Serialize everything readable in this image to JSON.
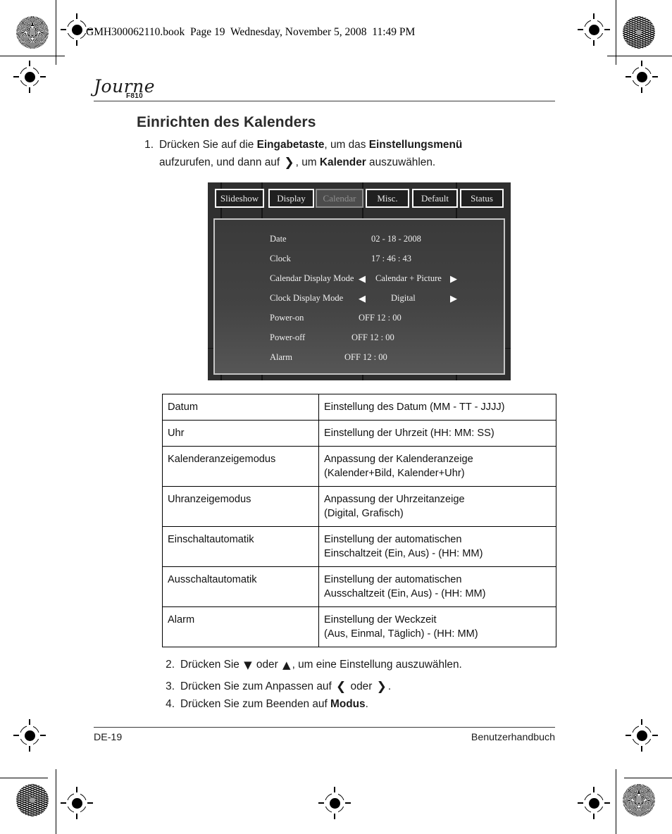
{
  "book_header": "GMH300062110.book  Page 19  Wednesday, November 5, 2008  11:49 PM",
  "logo": {
    "wordmark": "Journe",
    "model": "F810"
  },
  "title": "Einrichten des Kalenders",
  "steps": {
    "s1_num": "1.",
    "s1_a": "Drücken Sie auf die ",
    "s1_b": "Eingabetaste",
    "s1_c": ", um das ",
    "s1_d": "Einstellungsmenü",
    "s1_e": "aufzurufen, und dann auf ",
    "s1_glyph": "❯",
    "s1_f": ", um ",
    "s1_g": "Kalender",
    "s1_h": " auszuwählen.",
    "s2_num": "2.",
    "s2_a": "Drücken Sie ",
    "s2_glyph_down": "▼",
    "s2_b": " oder ",
    "s2_glyph_up": "▲",
    "s2_c": ", um eine Einstellung auszuwählen.",
    "s3_num": "3.",
    "s3_a": "Drücken Sie zum Anpassen auf ",
    "s3_glyph_left": "❮",
    "s3_b": " oder ",
    "s3_glyph_right": "❯",
    "s3_c": ".",
    "s4_num": "4.",
    "s4_a": "Drücken Sie zum Beenden auf ",
    "s4_b": "Modus",
    "s4_c": "."
  },
  "device": {
    "tabs": [
      {
        "label": "Slideshow",
        "selected": false
      },
      {
        "label": "Display",
        "selected": false
      },
      {
        "label": "Calendar",
        "selected": true
      },
      {
        "label": "Misc.",
        "selected": false
      },
      {
        "label": "Default",
        "selected": false
      },
      {
        "label": "Status",
        "selected": false
      }
    ],
    "rows": [
      {
        "label": "Date",
        "value": "02   -   18   - 2008",
        "left_arrow": "",
        "right_arrow": ""
      },
      {
        "label": "Clock",
        "value": "17   :   46   : 43",
        "left_arrow": "",
        "right_arrow": ""
      },
      {
        "label": "Calendar Display Mode",
        "value": "Calendar + Picture",
        "left_arrow": "◀",
        "right_arrow": "▶"
      },
      {
        "label": "Clock Display Mode",
        "value": "Digital",
        "left_arrow": "◀",
        "right_arrow": "▶"
      },
      {
        "label": "Power-on",
        "value": "OFF     12   :    00",
        "left_arrow": "",
        "right_arrow": ""
      },
      {
        "label": "Power-off",
        "value": "OFF     12   :    00",
        "left_arrow": "",
        "right_arrow": ""
      },
      {
        "label": "Alarm",
        "value": "OFF     12   :    00",
        "left_arrow": "",
        "right_arrow": ""
      }
    ]
  },
  "table": {
    "rows": [
      {
        "term": "Datum",
        "desc1": "Einstellung des Datum (MM - TT - JJJJ)",
        "desc2": ""
      },
      {
        "term": "Uhr",
        "desc1": "Einstellung der Uhrzeit (HH: MM: SS)",
        "desc2": ""
      },
      {
        "term": "Kalenderanzeigemodus",
        "desc1": "Anpassung der Kalenderanzeige",
        "desc2": "(Kalender+Bild, Kalender+Uhr)"
      },
      {
        "term": "Uhranzeigemodus",
        "desc1": "Anpassung der Uhrzeitanzeige",
        "desc2": "(Digital, Grafisch)"
      },
      {
        "term": "Einschaltautomatik",
        "desc1": "Einstellung der automatischen",
        "desc2": "Einschaltzeit (Ein, Aus) - (HH: MM)"
      },
      {
        "term": "Ausschaltautomatik",
        "desc1": "Einstellung der automatischen",
        "desc2": "Ausschaltzeit (Ein, Aus) - (HH: MM)"
      },
      {
        "term": "Alarm",
        "desc1": "Einstellung der Weckzeit",
        "desc2": "(Aus, Einmal, Täglich) - (HH: MM)"
      }
    ]
  },
  "footer": {
    "left": "DE-19",
    "right": "Benutzerhandbuch"
  }
}
